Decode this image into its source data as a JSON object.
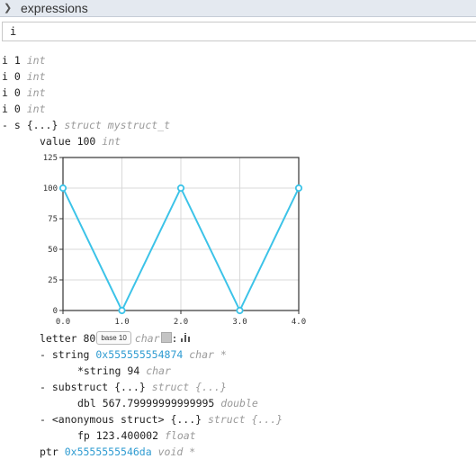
{
  "panel": {
    "title": "expressions"
  },
  "input": {
    "value": "i"
  },
  "rows": [
    {
      "name": "i",
      "value": "1",
      "type": "int"
    },
    {
      "name": "i",
      "value": "0",
      "type": "int"
    },
    {
      "name": "i",
      "value": "0",
      "type": "int"
    },
    {
      "name": "i",
      "value": "0",
      "type": "int"
    }
  ],
  "struct_s": {
    "toggle": "-",
    "name": "s",
    "brace": "{...}",
    "type": "struct mystruct_t"
  },
  "value_row": {
    "name": "value",
    "value": "100",
    "type": "int"
  },
  "letter_row": {
    "name": "letter",
    "value": "80",
    "base_button": "base 10",
    "type": "char",
    "colon": ":"
  },
  "string_row": {
    "toggle": "-",
    "name": "string",
    "addr": "0x555555554874",
    "type": "char *"
  },
  "deref_row": {
    "name": "*string",
    "value": "94",
    "type": "char"
  },
  "substruct_row": {
    "toggle": "-",
    "name": "substruct",
    "brace": "{...}",
    "type": "struct {...}"
  },
  "dbl_row": {
    "name": "dbl",
    "value": "567.79999999999995",
    "type": "double"
  },
  "anon_row": {
    "toggle": "-",
    "name": "<anonymous struct>",
    "brace": "{...}",
    "type": "struct {...}"
  },
  "fp_row": {
    "name": "fp",
    "value": "123.400002",
    "type": "float"
  },
  "ptr_row": {
    "name": "ptr",
    "addr": "0x5555555546da",
    "type": "void *"
  },
  "chart_data": {
    "type": "line",
    "x": [
      0.0,
      1.0,
      2.0,
      3.0,
      4.0
    ],
    "series": [
      {
        "values": [
          100,
          0,
          100,
          0,
          100
        ]
      }
    ],
    "xlim": [
      0,
      4
    ],
    "ylim": [
      0,
      125
    ],
    "xticks": [
      "0.0",
      "1.0",
      "2.0",
      "3.0",
      "4.0"
    ],
    "yticks": [
      "0",
      "25",
      "50",
      "75",
      "100",
      "125"
    ],
    "grid": true,
    "line_color": "#3cc3e8"
  }
}
